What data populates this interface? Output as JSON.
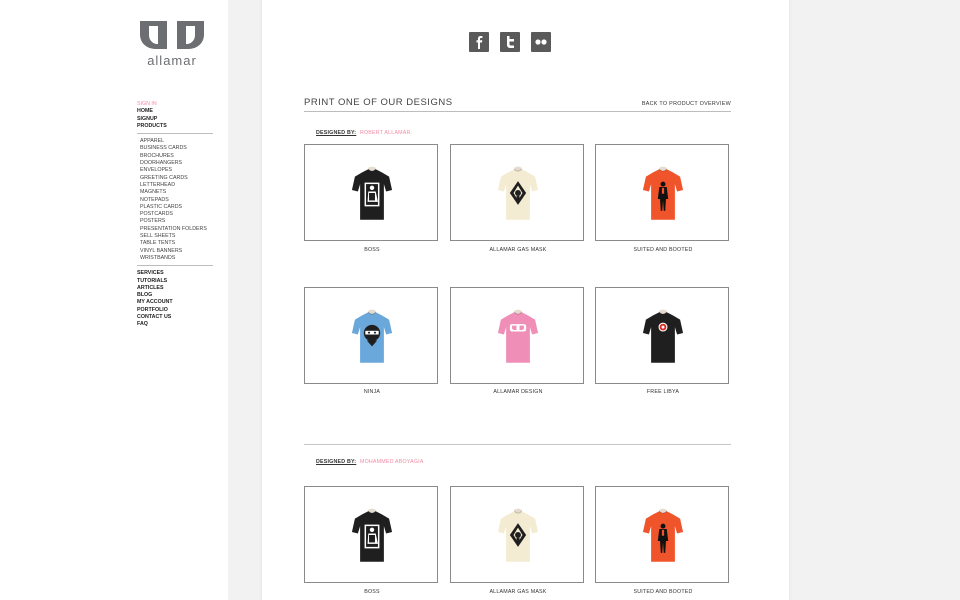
{
  "brand": {
    "logo_text": "allamar"
  },
  "sidebar": {
    "sign_in": "SIGN IN",
    "main_items": [
      "HOME",
      "SIGNUP",
      "PRODUCTS"
    ],
    "product_items": [
      "APPAREL",
      "BUSINESS CARDS",
      "BROCHURES",
      "DOORHANGERS",
      "ENVELOPES",
      "GREETING CARDS",
      "LETTERHEAD",
      "MAGNETS",
      "NOTEPADS",
      "PLASTIC CARDS",
      "POSTCARDS",
      "POSTERS",
      "PRESENTATION FOLDERS",
      "SELL SHEETS",
      "TABLE TENTS",
      "VINYL BANNERS",
      "WRISTBANDS"
    ],
    "secondary_items": [
      "SERVICES",
      "TUTORIALS",
      "ARTICLES",
      "BLOG",
      "MY ACCOUNT",
      "PORTFOLIO",
      "CONTACT US",
      "FAQ"
    ]
  },
  "social": [
    "facebook-icon",
    "twitter-icon",
    "flickr-icon"
  ],
  "section": {
    "title": "PRINT ONE OF OUR DESIGNS",
    "back_link": "BACK TO PRODUCT OVERVIEW"
  },
  "groups": [
    {
      "designed_by_label": "DESIGNED BY:",
      "designer": "ROBERT ALLAMAR",
      "products": [
        {
          "name": "BOSS",
          "shirt_color": "#1f1f1f",
          "graphic": "boss"
        },
        {
          "name": "ALLAMAR GAS MASK",
          "shirt_color": "#f3ecd2",
          "graphic": "gasmask"
        },
        {
          "name": "SUITED AND BOOTED",
          "shirt_color": "#f0542a",
          "graphic": "suited"
        },
        {
          "name": "NINJA",
          "shirt_color": "#6aa7db",
          "graphic": "ninja"
        },
        {
          "name": "ALLAMAR DESIGN",
          "shirt_color": "#ef8fb8",
          "graphic": "logo"
        },
        {
          "name": "FREE LIBYA",
          "shirt_color": "#1f1f1f",
          "graphic": "libya"
        }
      ]
    },
    {
      "designed_by_label": "DESIGNED BY:",
      "designer": "MOHAMMED ABOYAGIA",
      "products": [
        {
          "name": "BOSS",
          "shirt_color": "#1f1f1f",
          "graphic": "boss"
        },
        {
          "name": "ALLAMAR GAS MASK",
          "shirt_color": "#f3ecd2",
          "graphic": "gasmask"
        },
        {
          "name": "SUITED AND BOOTED",
          "shirt_color": "#f0542a",
          "graphic": "suited"
        }
      ]
    }
  ],
  "colors": {
    "accent": "#f28da6",
    "logo_gray": "#6d6e71",
    "icon_gray": "#5a5a5a"
  }
}
